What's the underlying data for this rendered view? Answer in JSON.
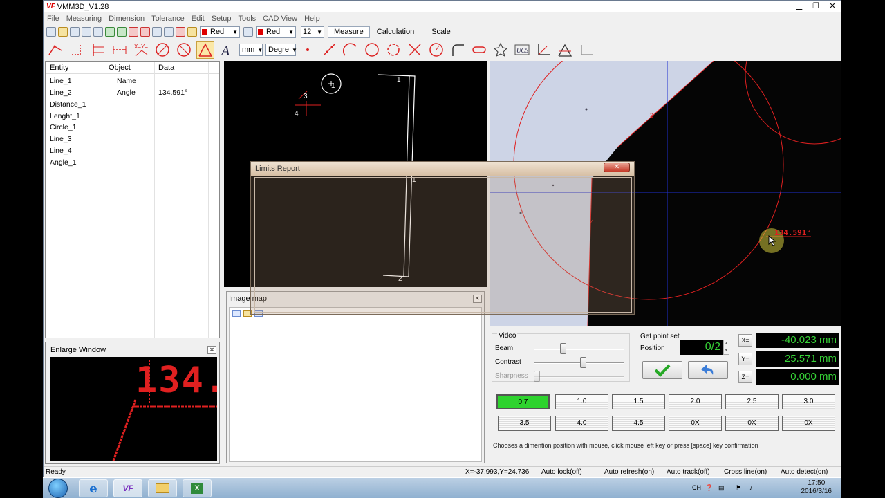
{
  "app": {
    "title": "VMM3D_V1.28",
    "logo": "VF"
  },
  "menu": [
    "File",
    "Measuring",
    "Dimension",
    "Tolerance",
    "Edit",
    "Setup",
    "Tools",
    "CAD View",
    "Help"
  ],
  "toolbar": {
    "color1": "Red",
    "color2": "Red",
    "size": "12",
    "tabs": [
      "Measure",
      "Calculation",
      "Scale"
    ],
    "unit": "mm",
    "angle_unit": "Degre"
  },
  "entity_table": {
    "headers": {
      "entity": "Entity",
      "object": "Object",
      "data": "Data"
    },
    "entities": [
      "Line_1",
      "Line_2",
      "Distance_1",
      "Lenght_1",
      "Circle_1",
      "Line_3",
      "Line_4",
      "Angle_1"
    ],
    "props": [
      {
        "name": "Name",
        "value": ""
      },
      {
        "name": "Angle",
        "value": "134.591°"
      }
    ]
  },
  "enlarge": {
    "title": "Enlarge Window",
    "readout": "134."
  },
  "image_map": {
    "title": "Image map"
  },
  "cad_labels": {
    "p1a": "1",
    "p1b": "1",
    "p1c": "1",
    "p2": "2",
    "p3": "3",
    "p4": "4"
  },
  "camera": {
    "angle_label": "134.591°",
    "pt3": "3",
    "pt4": "4"
  },
  "dialog": {
    "title": "Limits Report",
    "close": "✕"
  },
  "video": {
    "group": "Video",
    "beam": "Beam",
    "contrast": "Contrast",
    "sharpness": "Sharpness"
  },
  "pointset": {
    "group": "Get point set",
    "position_label": "Position",
    "position_value": "0/2"
  },
  "coords": {
    "x_label": "X=",
    "y_label": "Y=",
    "z_label": "Z=",
    "x": "-40.023 mm",
    "y": "25.571 mm",
    "z": "0.000 mm"
  },
  "zoom": [
    "0.7",
    "1.0",
    "1.5",
    "2.0",
    "2.5",
    "3.0",
    "3.5",
    "4.0",
    "4.5",
    "0X",
    "0X",
    "0X"
  ],
  "zoom_selected_index": 0,
  "hint": "Chooses a dimention position with mouse, click mouse left key or press [space] key confirmation",
  "status": {
    "ready": "Ready",
    "cursor": "X=-37.993,Y=24.736",
    "auto_lock": "Auto lock(off)",
    "auto_refresh": "Auto refresh(on)",
    "auto_track": "Auto track(off)",
    "cross_line": "Cross line(on)",
    "auto_detect": "Auto detect(on)"
  },
  "taskbar": {
    "time": "17:50",
    "date": "2016/3/16",
    "ime": "CH",
    "vf_label": "VF"
  },
  "colors": {
    "accent_green": "#36d136",
    "selected_zoom": "#2ed32e",
    "cad_red": "#e02020"
  }
}
